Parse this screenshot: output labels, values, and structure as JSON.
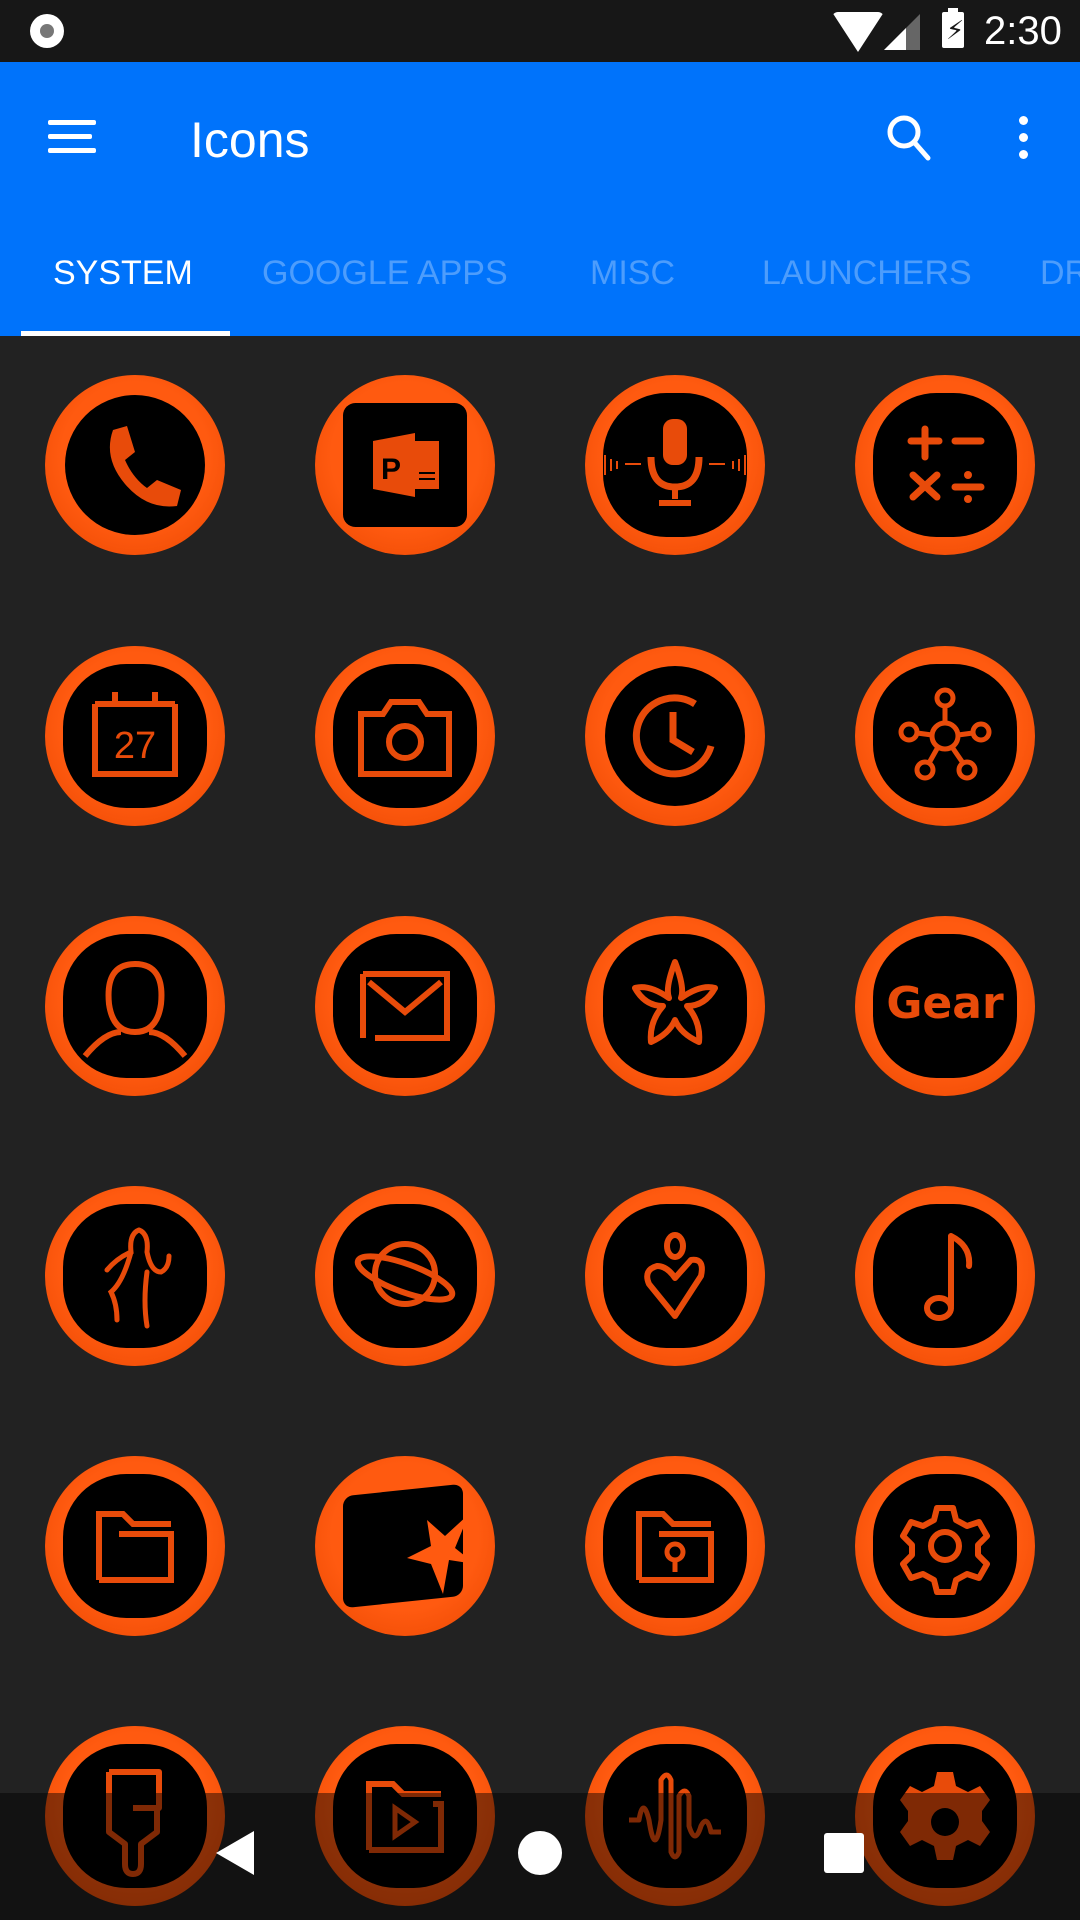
{
  "status_bar": {
    "time": "2:30",
    "icons": [
      "record-icon",
      "wifi-icon",
      "cell-signal-icon",
      "battery-charging-icon"
    ]
  },
  "app_bar": {
    "title": "Icons",
    "menu_icon": "hamburger-menu-icon",
    "search_icon": "search-icon",
    "more_icon": "more-vert-icon",
    "background": "#0073fb"
  },
  "tabs": [
    {
      "label": "SYSTEM",
      "active": true
    },
    {
      "label": "GOOGLE APPS",
      "active": false
    },
    {
      "label": "MISC",
      "active": false
    },
    {
      "label": "LAUNCHERS",
      "active": false
    },
    {
      "label": "DR",
      "active": false
    }
  ],
  "theme": {
    "icon_orange": "#ff5a10",
    "icon_black": "#000000",
    "background": "#222222"
  },
  "icons": [
    {
      "name": "phone",
      "glyph": "phone-icon"
    },
    {
      "name": "powerpoint",
      "glyph": "powerpoint-icon",
      "text": "P"
    },
    {
      "name": "voice-recorder",
      "glyph": "microphone-icon"
    },
    {
      "name": "calculator",
      "glyph": "calculator-icon"
    },
    {
      "name": "calendar",
      "glyph": "calendar-icon",
      "text": "27"
    },
    {
      "name": "camera",
      "glyph": "camera-icon"
    },
    {
      "name": "clock",
      "glyph": "clock-icon"
    },
    {
      "name": "smartthings",
      "glyph": "hub-icon"
    },
    {
      "name": "contacts",
      "glyph": "contact-person-icon"
    },
    {
      "name": "email",
      "glyph": "email-icon"
    },
    {
      "name": "bixby-vision",
      "glyph": "flower-icon"
    },
    {
      "name": "galaxy-wearable",
      "glyph": "gear-text-icon",
      "text": "Gear"
    },
    {
      "name": "samsung-health",
      "glyph": "runner-icon"
    },
    {
      "name": "samsung-internet",
      "glyph": "planet-icon"
    },
    {
      "name": "samsung-members",
      "glyph": "heart-person-icon"
    },
    {
      "name": "music",
      "glyph": "music-note-icon"
    },
    {
      "name": "my-files",
      "glyph": "folder-icon"
    },
    {
      "name": "video-editor",
      "glyph": "video-star-icon"
    },
    {
      "name": "secure-folder",
      "glyph": "secure-folder-icon"
    },
    {
      "name": "settings",
      "glyph": "settings-icon"
    },
    {
      "name": "theme-store",
      "glyph": "paint-brush-icon"
    },
    {
      "name": "video-folder",
      "glyph": "video-folder-icon"
    },
    {
      "name": "sound-wave",
      "glyph": "sound-wave-icon"
    },
    {
      "name": "settings-gear",
      "glyph": "cog-icon"
    }
  ],
  "nav_bar": {
    "buttons": [
      "back-icon",
      "home-icon",
      "recents-icon"
    ]
  }
}
